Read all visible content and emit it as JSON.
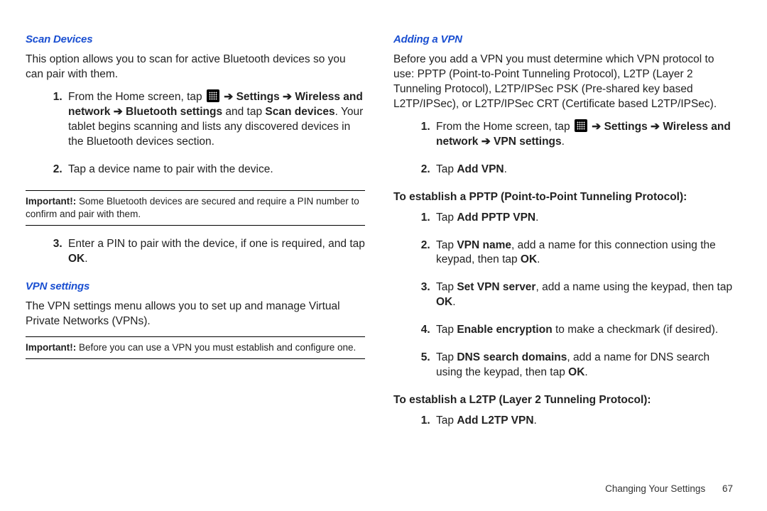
{
  "left": {
    "h1": "Scan Devices",
    "p1": "This option allows you to scan for active Bluetooth devices so you can pair with them.",
    "step1_a": "From the Home screen, tap ",
    "step1_b": " ➔ Settings ➔ Wireless and network ➔ Bluetooth settings",
    "step1_c": " and tap ",
    "step1_d": "Scan devices",
    "step1_e": ". Your tablet begins scanning and lists any discovered devices in the Bluetooth devices section.",
    "step2": "Tap a device name to pair with the device.",
    "note1_lbl": "Important!:",
    "note1_txt": " Some Bluetooth devices are secured and require a PIN number to confirm and pair with them.",
    "step3_a": "Enter a PIN to pair with the device, if one is required, and tap ",
    "step3_b": "OK",
    "step3_c": ".",
    "h2": "VPN settings",
    "p2": "The VPN settings menu allows you to set up and manage Virtual Private Networks (VPNs).",
    "note2_lbl": "Important!:",
    "note2_txt": " Before you can use a VPN you must establish and configure one."
  },
  "right": {
    "h1": "Adding a VPN",
    "p1": "Before you add a VPN you must determine which VPN protocol to use: PPTP (Point-to-Point Tunneling Protocol), L2TP (Layer 2 Tunneling Protocol), L2TP/IPSec PSK (Pre-shared key based L2TP/IPSec), or L2TP/IPSec CRT (Certificate based L2TP/IPSec).",
    "step1_a": "From the Home screen, tap ",
    "step1_b": " ➔ Settings ➔ Wireless and network ➔ VPN settings",
    "step1_c": ".",
    "step2_a": "Tap ",
    "step2_b": "Add VPN",
    "step2_c": ".",
    "sub1": "To establish a PPTP (Point-to-Point Tunneling Protocol):",
    "p_step1_a": "Tap ",
    "p_step1_b": "Add PPTP VPN",
    "p_step1_c": ".",
    "p_step2_a": "Tap ",
    "p_step2_b": "VPN name",
    "p_step2_c": ", add a name for this connection using the keypad, then tap ",
    "p_step2_d": "OK",
    "p_step2_e": ".",
    "p_step3_a": "Tap ",
    "p_step3_b": "Set VPN server",
    "p_step3_c": ", add a name using the keypad, then tap ",
    "p_step3_d": "OK",
    "p_step3_e": ".",
    "p_step4_a": "Tap ",
    "p_step4_b": "Enable encryption",
    "p_step4_c": " to make a checkmark (if desired).",
    "p_step5_a": "Tap ",
    "p_step5_b": "DNS search domains",
    "p_step5_c": ", add a name for DNS search using the keypad, then tap ",
    "p_step5_d": "OK",
    "p_step5_e": ".",
    "sub2": "To establish a L2TP (Layer 2 Tunneling Protocol):",
    "l_step1_a": "Tap ",
    "l_step1_b": "Add L2TP VPN",
    "l_step1_c": "."
  },
  "footer": {
    "section": "Changing Your Settings",
    "page": "67"
  }
}
